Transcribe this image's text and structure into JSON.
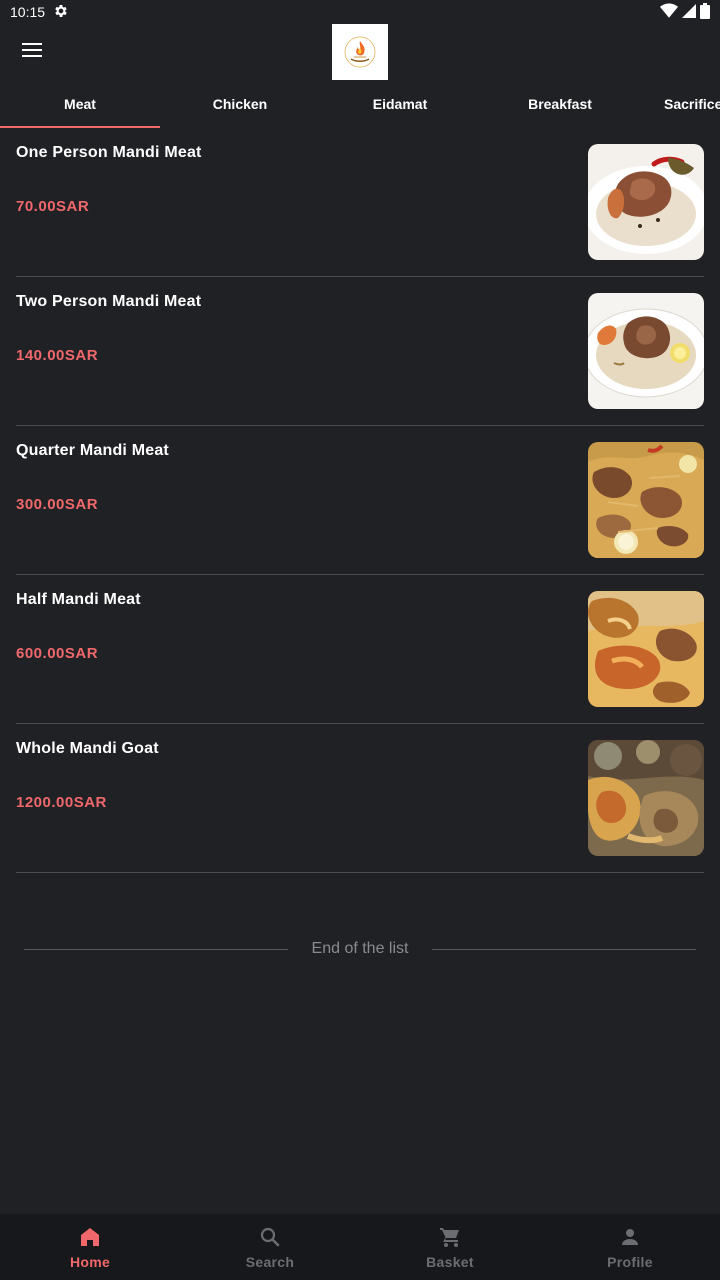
{
  "status": {
    "time": "10:15"
  },
  "tabs": [
    {
      "label": "Meat"
    },
    {
      "label": "Chicken"
    },
    {
      "label": "Eidamat"
    },
    {
      "label": "Breakfast"
    },
    {
      "label": "Sacrifice"
    }
  ],
  "items": [
    {
      "name": "One Person Mandi Meat",
      "price": "70.00SAR"
    },
    {
      "name": "Two Person Mandi Meat",
      "price": "140.00SAR"
    },
    {
      "name": "Quarter Mandi Meat",
      "price": "300.00SAR"
    },
    {
      "name": "Half Mandi Meat",
      "price": "600.00SAR"
    },
    {
      "name": "Whole Mandi Goat",
      "price": "1200.00SAR"
    }
  ],
  "end_of_list": "End of the list",
  "nav": {
    "home": "Home",
    "search": "Search",
    "basket": "Basket",
    "profile": "Profile"
  },
  "colors": {
    "accent": "#f0686b",
    "background": "#202125",
    "nav_background": "#17181b"
  }
}
